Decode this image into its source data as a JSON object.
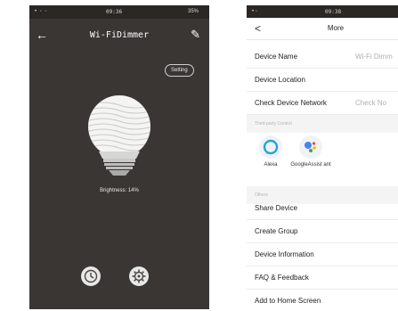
{
  "left": {
    "status": {
      "time": "09:36",
      "battery": "35%"
    },
    "title": "Wi-FiDimmer",
    "setting_label": "Setting",
    "brightness_text": "Brightness: 14%"
  },
  "right": {
    "status": {
      "time": "09:38"
    },
    "nav": {
      "back": "<",
      "title": "More"
    },
    "rows_top": [
      {
        "label": "Device Name",
        "value": "Wi-Fi Dimm"
      },
      {
        "label": "Device Location",
        "value": ""
      },
      {
        "label": "Check Device Network",
        "value": "Check No"
      }
    ],
    "section_third_party": "Third-party Control",
    "third_party": [
      {
        "name": "Alexa"
      },
      {
        "name": "GoogleAssist ant"
      }
    ],
    "section_others": "Others",
    "rows_others": [
      {
        "label": "Share Device"
      },
      {
        "label": "Create Group"
      },
      {
        "label": "Device Information"
      },
      {
        "label": "FAQ & Feedback"
      },
      {
        "label": "Add to Home Screen"
      }
    ]
  }
}
